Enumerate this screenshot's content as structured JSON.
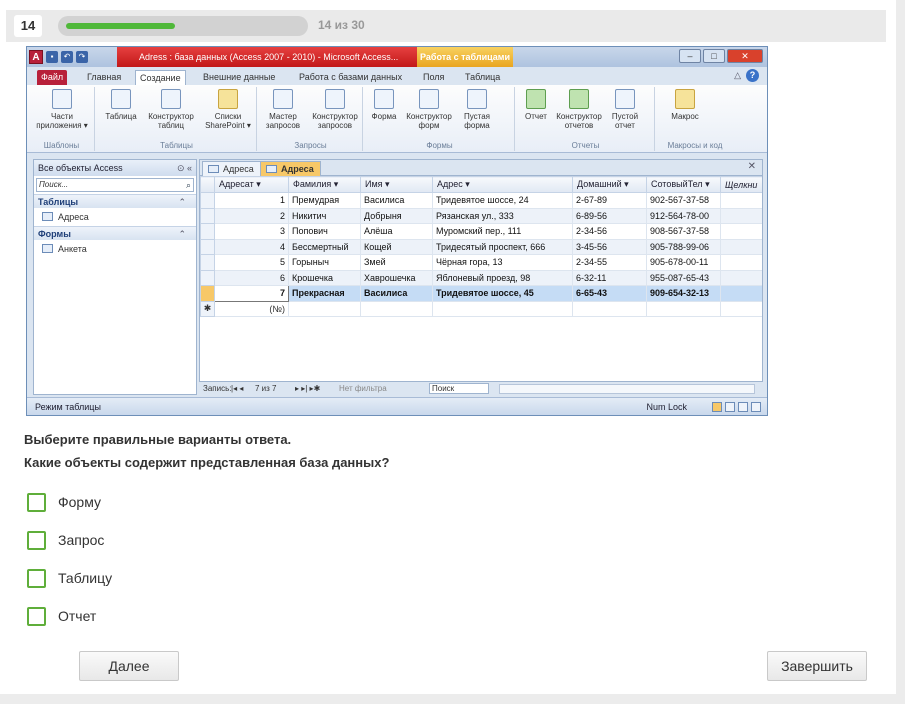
{
  "header": {
    "question_number": "14",
    "progress_text": "14 из 30",
    "progress_fraction": 0.467
  },
  "access": {
    "window_title": "Adress : база данных (Access 2007 - 2010) - Microsoft Access...",
    "tools_tab": "Работа с таблицами",
    "window_controls": {
      "minimize": "–",
      "maximize": "□",
      "close": "✕"
    },
    "ribbon_tabs": [
      "Файл",
      "Главная",
      "Создание",
      "Внешние данные",
      "Работа с базами данных",
      "Поля",
      "Таблица"
    ],
    "ribbon_groups": [
      {
        "label": "Шаблоны",
        "buttons": [
          "Части приложения ▾"
        ]
      },
      {
        "label": "Таблицы",
        "buttons": [
          "Таблица",
          "Конструктор таблиц",
          "Списки SharePoint ▾"
        ]
      },
      {
        "label": "Запросы",
        "buttons": [
          "Мастер запросов",
          "Конструктор запросов"
        ]
      },
      {
        "label": "Формы",
        "buttons": [
          "Форма",
          "Конструктор форм",
          "Пустая форма"
        ]
      },
      {
        "label": "Отчеты",
        "buttons": [
          "Отчет",
          "Конструктор отчетов",
          "Пустой отчет"
        ]
      },
      {
        "label": "Макросы и код",
        "buttons": [
          "Макрос"
        ]
      }
    ],
    "nav": {
      "header": "Все объекты Access",
      "search_placeholder": "Поиск...",
      "groups": [
        {
          "name": "Таблицы",
          "items": [
            "Адреса"
          ]
        },
        {
          "name": "Формы",
          "items": [
            "Анкета"
          ]
        }
      ]
    },
    "doc_tabs": [
      "Адреса",
      "Адреса"
    ],
    "table": {
      "columns": [
        "Адресат",
        "Фамилия",
        "Имя",
        "Адрес",
        "Домашний",
        "СотовыйТел",
        "Щелкни"
      ],
      "rows": [
        [
          "1",
          "Премудрая",
          "Василиса",
          "Тридевятое шоссе, 24",
          "2-67-89",
          "902-567-37-58"
        ],
        [
          "2",
          "Никитич",
          "Добрыня",
          "Рязанская ул., 333",
          "6-89-56",
          "912-564-78-00"
        ],
        [
          "3",
          "Попович",
          "Алёша",
          "Муромский пер., 111",
          "2-34-56",
          "908-567-37-58"
        ],
        [
          "4",
          "Бессмертный",
          "Кощей",
          "Тридесятый проспект, 666",
          "3-45-56",
          "905-788-99-06"
        ],
        [
          "5",
          "Горыныч",
          "Змей",
          "Чёрная гора, 13",
          "2-34-55",
          "905-678-00-11"
        ],
        [
          "6",
          "Крошечка",
          "Хаврошечка",
          "Яблоневый проезд, 98",
          "6-32-11",
          "955-087-65-43"
        ],
        [
          "7",
          "Прекрасная",
          "Василиса",
          "Тридевятое шоссе, 45",
          "6-65-43",
          "909-654-32-13"
        ]
      ],
      "new_row_marker": "(№)"
    },
    "record_nav": {
      "label": "Запись: ",
      "position": "7 из 7",
      "filter": "Нет фильтра",
      "search": "Поиск"
    },
    "status": {
      "left": "Режим таблицы",
      "right": "Num Lock"
    }
  },
  "question": {
    "instruction": "Выберите правильные варианты ответа.",
    "text": "Какие объекты содержит представленная база данных?",
    "options": [
      "Форму",
      "Запрос",
      "Таблицу",
      "Отчет"
    ]
  },
  "buttons": {
    "next": "Далее",
    "finish": "Завершить"
  },
  "colors": {
    "accent_green": "#4fb839",
    "access_red": "#c21818",
    "selection_gold": "#f7c868"
  }
}
